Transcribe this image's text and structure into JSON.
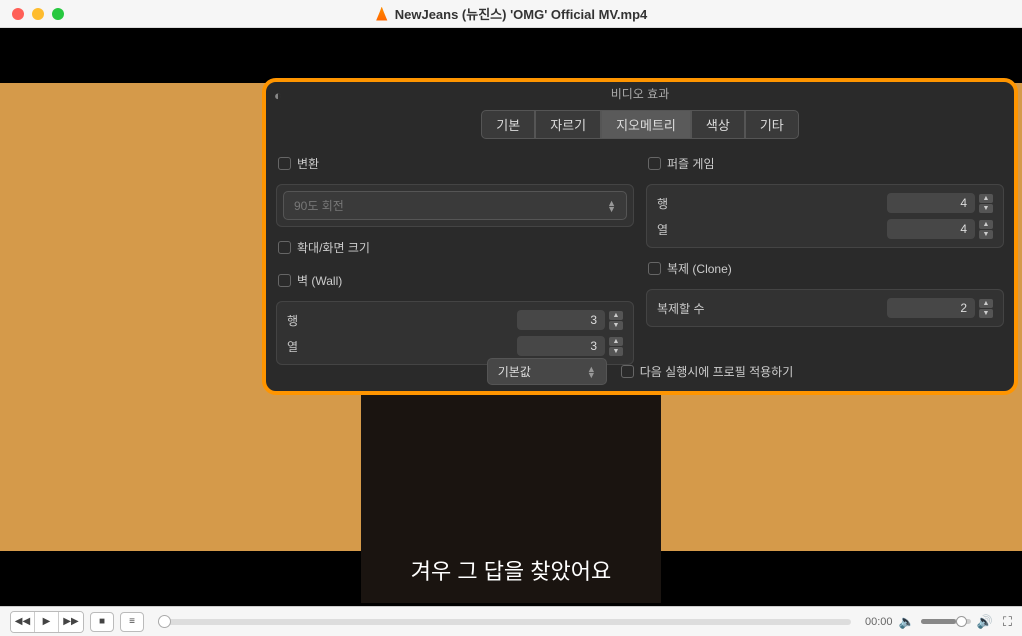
{
  "window": {
    "title": "NewJeans (뉴진스) 'OMG' Official MV.mp4"
  },
  "subtitle": "겨우 그 답을 찾았어요",
  "effects": {
    "title": "비디오 효과",
    "tabs": {
      "basic": "기본",
      "crop": "자르기",
      "geometry": "지오메트리",
      "color": "색상",
      "other": "기타"
    },
    "transform": {
      "label": "변환",
      "value": "90도 회전"
    },
    "zoom": {
      "label": "확대/화면 크기"
    },
    "wall": {
      "label": "벽 (Wall)",
      "rows_label": "행",
      "rows": "3",
      "cols_label": "열",
      "cols": "3"
    },
    "puzzle": {
      "label": "퍼즐 게임",
      "rows_label": "행",
      "rows": "4",
      "cols_label": "열",
      "cols": "4"
    },
    "clone": {
      "label": "복제 (Clone)",
      "count_label": "복제할 수",
      "count": "2"
    },
    "profile": {
      "default": "기본값",
      "apply_next": "다음 실행시에 프로필 적용하기"
    }
  },
  "controls": {
    "time": "00:00"
  }
}
